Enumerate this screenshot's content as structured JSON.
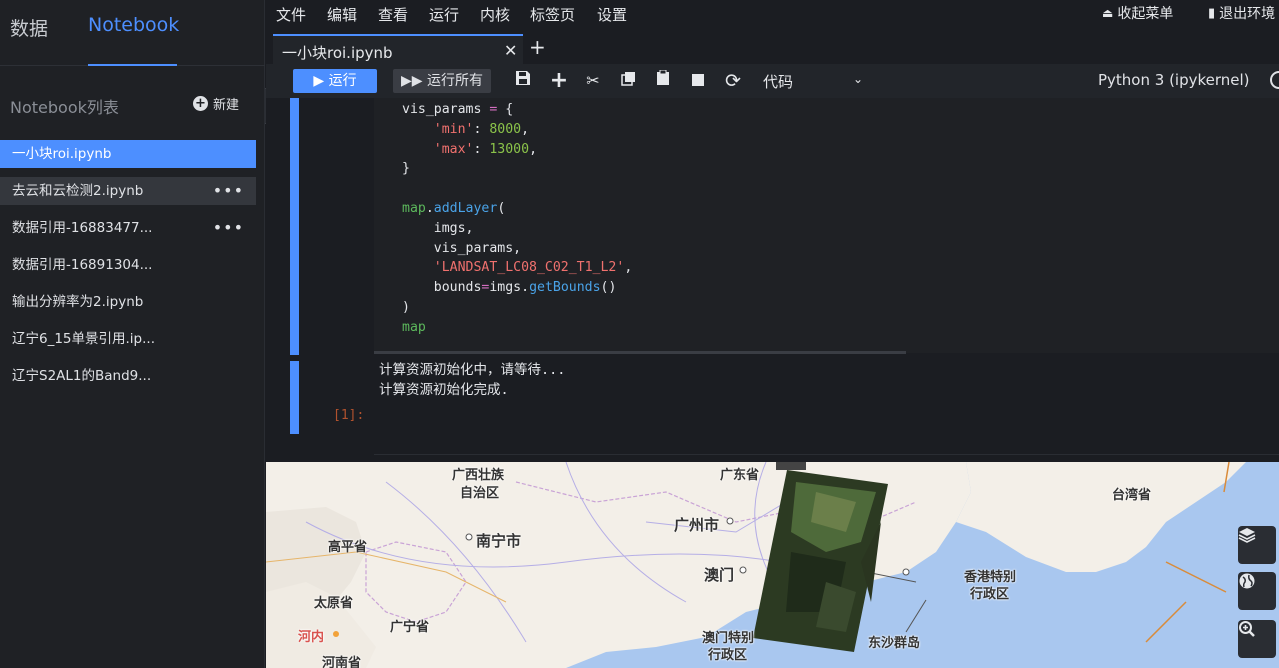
{
  "sidebar": {
    "tabs": [
      "数据",
      "Notebook"
    ],
    "list_title": "Notebook列表",
    "new_label": "新建",
    "notebooks": [
      {
        "name": "一小块roi.ipynb",
        "menu": ""
      },
      {
        "name": "去云和云检测2.ipynb",
        "menu": "•••"
      },
      {
        "name": "数据引用-16883477...",
        "menu": "•••"
      },
      {
        "name": "数据引用-16891304...",
        "menu": ""
      },
      {
        "name": "输出分辨率为2.ipynb",
        "menu": ""
      },
      {
        "name": "辽宁6_15单景引用.ip...",
        "menu": ""
      },
      {
        "name": "辽宁S2AL1的Band9...",
        "menu": ""
      }
    ]
  },
  "menubar": {
    "items": [
      "文件",
      "编辑",
      "查看",
      "运行",
      "内核",
      "标签页",
      "设置"
    ],
    "collapse_menu": "收起菜单",
    "exit_env": "退出环境"
  },
  "tab": {
    "title": "一小块roi.ipynb"
  },
  "toolbar": {
    "run_label": "▶ 运行",
    "run_all_label": "▶▶ 运行所有",
    "cell_type": "代码",
    "kernel": "Python 3 (ipykernel)"
  },
  "code_lines": [
    "vis_params = {",
    "    'min': 8000,",
    "    'max': 13000,",
    "}",
    "",
    "map.addLayer(",
    "    imgs,",
    "    vis_params,",
    "    'LANDSAT_LC08_C02_T1_L2',",
    "    bounds=imgs.getBounds()",
    ")",
    "map"
  ],
  "output_lines": [
    "计算资源初始化中，请等待...",
    "计算资源初始化完成."
  ],
  "prompt": "[1]:",
  "map": {
    "labels": {
      "guangxi": "广西壮族",
      "guangxi2": "自治区",
      "guangdong": "广东省",
      "taiwan": "台湾省",
      "guangzhou": "广州市",
      "nanning": "南宁市",
      "gaoping": "高平省",
      "macau": "澳门",
      "hongkong1": "香港特别",
      "hongkong2": "行政区",
      "taiyuan": "太原省",
      "guangning": "广宁省",
      "henei": "河内",
      "macau_sar1": "澳门特别",
      "macau_sar2": "行政区",
      "dongsha": "东沙群岛",
      "henan": "河南省"
    }
  }
}
